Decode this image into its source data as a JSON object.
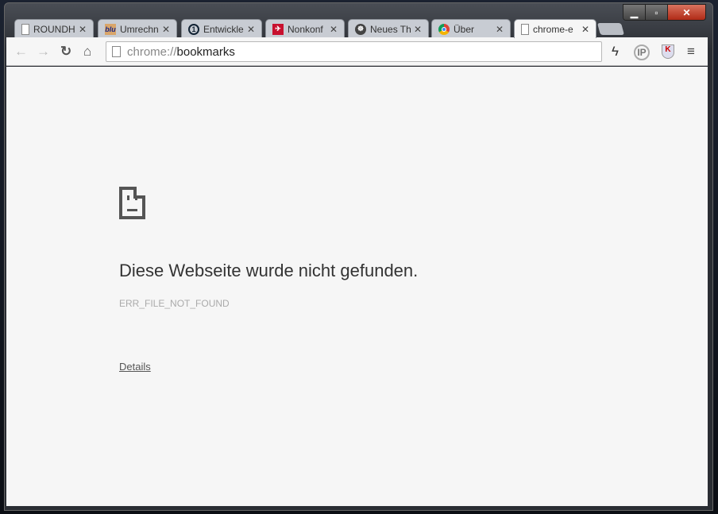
{
  "window": {
    "controls": [
      "minimize",
      "maximize",
      "close"
    ]
  },
  "tabs": [
    {
      "label": "ROUNDH",
      "icon": "page-icon"
    },
    {
      "label": "Umrechn",
      "icon": "blu-icon"
    },
    {
      "label": "Entwickle",
      "icon": "ard-icon"
    },
    {
      "label": "Nonkonf",
      "icon": "nonkonf-icon"
    },
    {
      "label": "Neues Th",
      "icon": "forum-icon"
    },
    {
      "label": "Über",
      "icon": "chrome-icon"
    },
    {
      "label": "chrome-e",
      "icon": "page-icon",
      "active": true
    }
  ],
  "toolbar": {
    "url_scheme": "chrome://",
    "url_host": "bookmarks",
    "extensions": [
      "flash-icon",
      "ip-lookup-icon",
      "kaspersky-icon",
      "menu-icon"
    ]
  },
  "page": {
    "title": "Diese Webseite wurde nicht gefunden.",
    "error_code": "ERR_FILE_NOT_FOUND",
    "details_link": "Details"
  }
}
